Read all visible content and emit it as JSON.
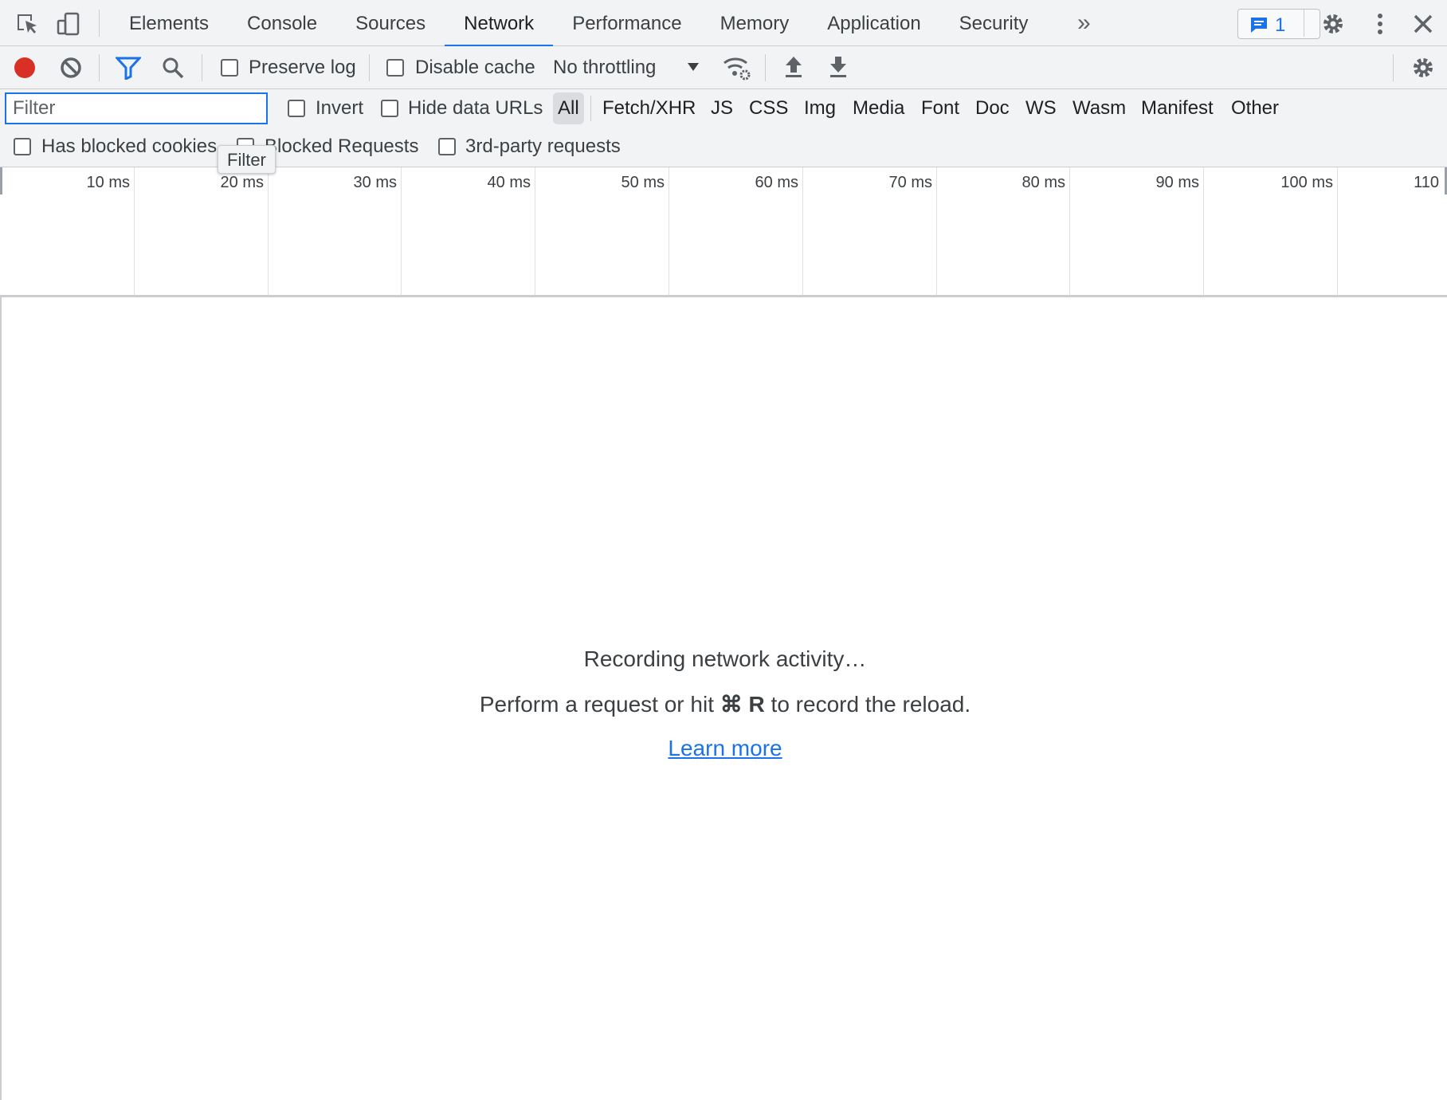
{
  "tabs": {
    "items": [
      {
        "label": "Elements"
      },
      {
        "label": "Console"
      },
      {
        "label": "Sources"
      },
      {
        "label": "Network",
        "active": true
      },
      {
        "label": "Performance"
      },
      {
        "label": "Memory"
      },
      {
        "label": "Application"
      },
      {
        "label": "Security"
      }
    ],
    "more_icon": "chevron-double-right-icon",
    "issues_count": "1"
  },
  "toolbar": {
    "preserve_log_label": "Preserve log",
    "disable_cache_label": "Disable cache",
    "throttling_value": "No throttling"
  },
  "filter": {
    "placeholder": "Filter",
    "invert_label": "Invert",
    "hide_data_urls_label": "Hide data URLs",
    "types": [
      "All",
      "Fetch/XHR",
      "JS",
      "CSS",
      "Img",
      "Media",
      "Font",
      "Doc",
      "WS",
      "Wasm",
      "Manifest",
      "Other"
    ],
    "active_type": "All",
    "has_blocked_cookies_label": "Has blocked cookies",
    "blocked_requests_label": "Blocked Requests",
    "third_party_label": "3rd-party requests",
    "tooltip": "Filter"
  },
  "overview": {
    "ticks": [
      "10 ms",
      "20 ms",
      "30 ms",
      "40 ms",
      "50 ms",
      "60 ms",
      "70 ms",
      "80 ms",
      "90 ms",
      "100 ms",
      "110"
    ]
  },
  "empty_state": {
    "title": "Recording network activity…",
    "hint_before": "Perform a request or hit ",
    "hint_key": "⌘ R",
    "hint_after": " to record the reload.",
    "link": "Learn more"
  },
  "colors": {
    "accent": "#1a73e8",
    "record": "#d93025",
    "toolbar_bg": "#f1f3f4"
  }
}
